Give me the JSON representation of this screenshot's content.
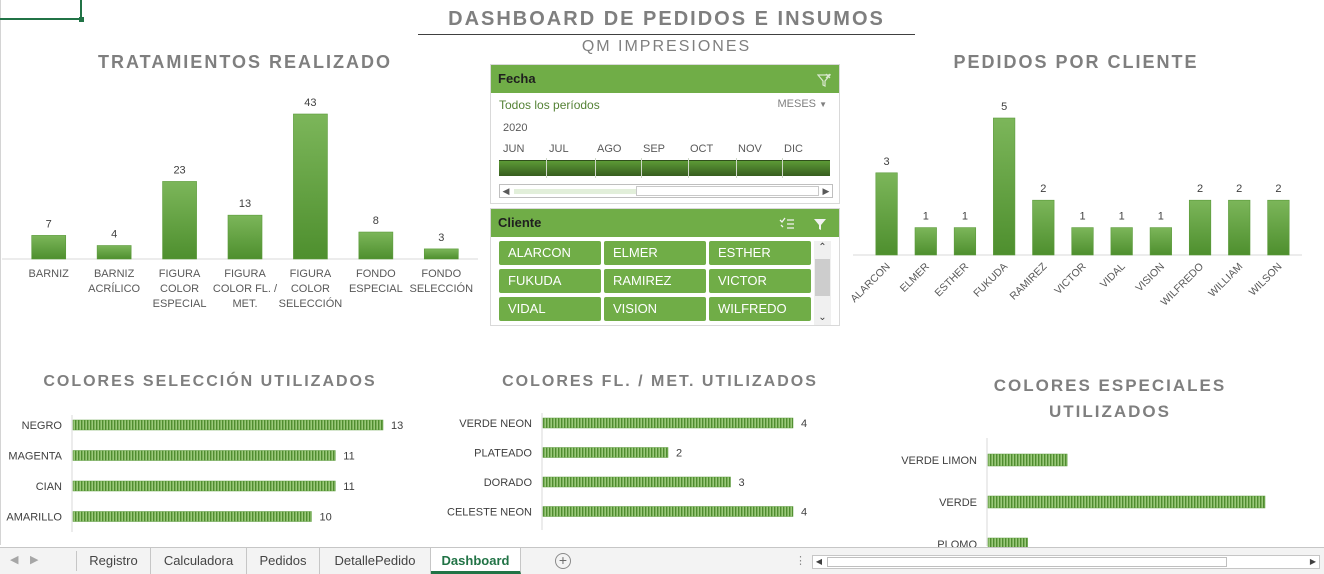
{
  "dashboard": {
    "title": "DASHBOARD DE PEDIDOS E INSUMOS",
    "subtitle": "QM IMPRESIONES"
  },
  "timeline": {
    "header": "Fecha",
    "all_periods": "Todos los períodos",
    "unit": "MESES",
    "year": "2020",
    "months": [
      "JUN",
      "JUL",
      "AGO",
      "SEP",
      "OCT",
      "NOV",
      "DIC"
    ],
    "clear_filter_icon": "clear-filter-icon"
  },
  "client_slicer": {
    "header": "Cliente",
    "multiselect_icon": "multiselect-icon",
    "clear_filter_icon": "filter-icon",
    "items": [
      "ALARCON",
      "ELMER",
      "ESTHER",
      "FUKUDA",
      "RAMIREZ",
      "VICTOR",
      "VIDAL",
      "VISION",
      "WILFREDO"
    ]
  },
  "sheet_tabs": {
    "tabs": [
      "Registro",
      "Calculadora",
      "Pedidos",
      "DetallePedido",
      "Dashboard"
    ],
    "active": "Dashboard"
  },
  "colors": {
    "accent_green": "#70ad47",
    "bar_green_dark": "#548235",
    "title_gray": "#7f7f7f"
  },
  "chart_data": [
    {
      "id": "tratamientos",
      "type": "bar",
      "title": "TRATAMIENTOS REALIZADO",
      "categories": [
        "BARNIZ",
        "BARNIZ ACRÍLICO",
        "FIGURA COLOR ESPECIAL",
        "FIGURA COLOR FL. / MET.",
        "FIGURA COLOR SELECCIÓN",
        "FONDO ESPECIAL",
        "FONDO SELECCIÓN"
      ],
      "category_lines": [
        [
          "BARNIZ"
        ],
        [
          "BARNIZ",
          "ACRÍLICO"
        ],
        [
          "FIGURA",
          "COLOR",
          "ESPECIAL"
        ],
        [
          "FIGURA",
          "COLOR FL. /",
          "MET."
        ],
        [
          "FIGURA",
          "COLOR",
          "SELECCIÓN"
        ],
        [
          "FONDO",
          "ESPECIAL"
        ],
        [
          "FONDO",
          "SELECCIÓN"
        ]
      ],
      "values": [
        7,
        4,
        23,
        13,
        43,
        8,
        3
      ],
      "ylim": [
        0,
        43
      ],
      "data_labels": true,
      "grid": false
    },
    {
      "id": "pedidos",
      "type": "bar",
      "title": "PEDIDOS POR CLIENTE",
      "categories": [
        "ALARCON",
        "ELMER",
        "ESTHER",
        "FUKUDA",
        "RAMIREZ",
        "VICTOR",
        "VIDAL",
        "VISION",
        "WILFREDO",
        "WILLIAM",
        "WILSON"
      ],
      "values": [
        3,
        1,
        1,
        5,
        2,
        1,
        1,
        1,
        2,
        2,
        2
      ],
      "ylim": [
        0,
        5
      ],
      "data_labels": true,
      "grid": false
    },
    {
      "id": "colores_seleccion",
      "type": "bar",
      "orientation": "horizontal",
      "title": "COLORES SELECCIÓN UTILIZADOS",
      "categories": [
        "NEGRO",
        "MAGENTA",
        "CIAN",
        "AMARILLO"
      ],
      "values": [
        13,
        11,
        11,
        10
      ],
      "data_labels": true
    },
    {
      "id": "colores_fl_met",
      "type": "bar",
      "orientation": "horizontal",
      "title": "COLORES FL. / MET. UTILIZADOS",
      "categories": [
        "VERDE NEON",
        "PLATEADO",
        "DORADO",
        "CELESTE NEON"
      ],
      "values": [
        4,
        2,
        3,
        4
      ],
      "data_labels": true
    },
    {
      "id": "colores_especiales",
      "type": "bar",
      "orientation": "horizontal",
      "title": "COLORES ESPECIALES UTILIZADOS",
      "title_lines": [
        "COLORES ESPECIALES",
        "UTILIZADOS"
      ],
      "categories": [
        "VERDE LIMON",
        "VERDE",
        "PLOMO"
      ],
      "values": [
        2,
        7,
        1
      ],
      "data_labels": false
    }
  ]
}
